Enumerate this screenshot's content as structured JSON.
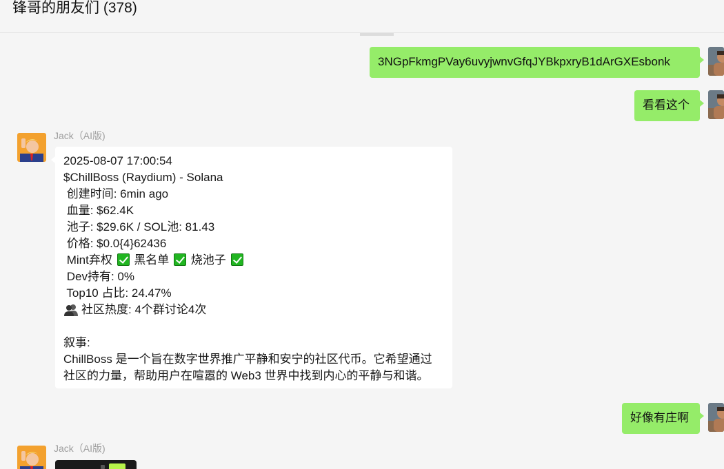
{
  "header": {
    "title": "锋哥的朋友们 (378)"
  },
  "messages": [
    {
      "text": "3NGpFkmgPVay6uvyjwnvGfqJYBkpxryB1dArGXEsbonk"
    },
    {
      "text": "看看这个"
    },
    {
      "sender": "Jack（AI版)",
      "lines": {
        "datetime": "2025-08-07 17:00:54",
        "token": "$ChillBoss (Raydium) - Solana",
        "created": " 创建时间: 6min ago",
        "blood": " 血量: $62.4K",
        "pool": " 池子: $29.6K / SOL池: 81.43",
        "price": " 价格: $0.0{4}62436",
        "mint": " Mint弃权",
        "blacklist": "黑名单",
        "burn": "烧池子",
        "dev": " Dev持有: 0%",
        "top10": " Top10 占比: 24.47%",
        "community": "社区热度: 4个群讨论4次",
        "narrative_label": "叙事:",
        "narrative_1": "ChillBoss 是一个旨在数字世界推广平静和安宁的社区代币。它希望通过",
        "narrative_2": "社区的力量，帮助用户在喧嚣的 Web3 世界中找到内心的平静与和谐。"
      }
    },
    {
      "text": "好像有庄啊"
    },
    {
      "sender": "Jack（AI版)"
    }
  ],
  "icons": {
    "self_avatar": "muscular-man-avatar",
    "jack_avatar": "cartoon-president-avatar",
    "check": "check-mark-button-emoji",
    "people": "busts-in-silhouette-emoji"
  },
  "colors": {
    "out_bubble": "#95ec69",
    "in_bubble": "#ffffff",
    "background": "#f5f5f5"
  }
}
